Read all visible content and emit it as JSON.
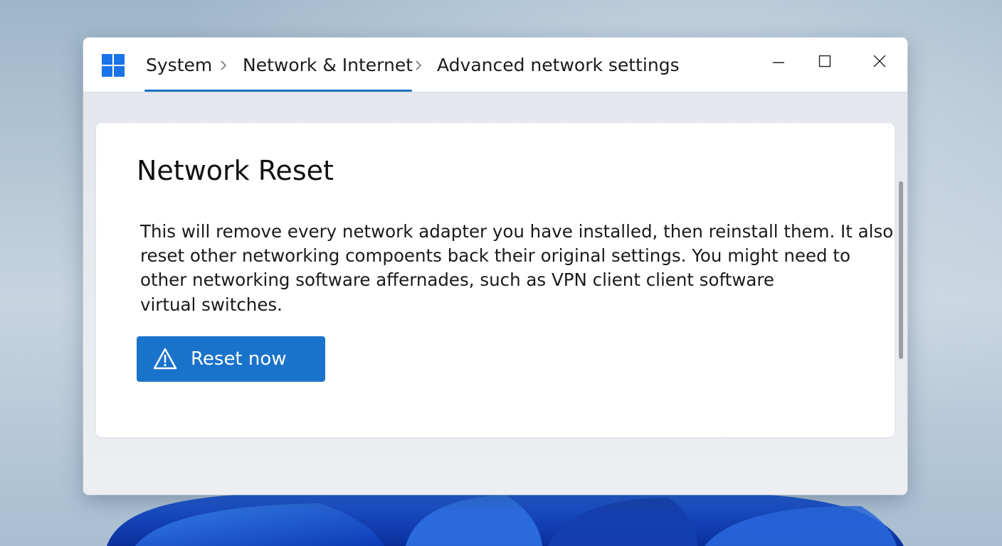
{
  "window": {
    "breadcrumb": [
      "System",
      "Network & Internet",
      "Advanced network settings"
    ],
    "controls": [
      "minimize-icon",
      "maximize-icon",
      "close-icon"
    ]
  },
  "card": {
    "title": "Network Reset",
    "description_lines": [
      "This will remove every network adapter you have installed, then reinstall them. It also",
      "reset other networking compoents back their original settings. You might need to",
      "other networking software affernades, such as VPN client client software",
      "virtual switches."
    ],
    "button_label": "Reset now",
    "button_icon": "warning-icon"
  },
  "colors": {
    "accent": "#1a73cb",
    "logo": "#1a73e8",
    "background": "#b4c6d5"
  }
}
